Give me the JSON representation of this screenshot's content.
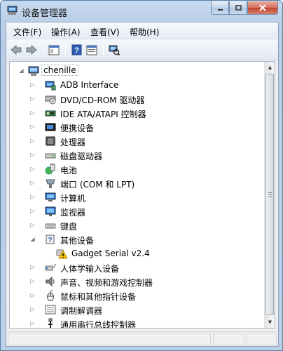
{
  "window": {
    "title": "设备管理器"
  },
  "menu": [
    {
      "label": "文件(F)"
    },
    {
      "label": "操作(A)"
    },
    {
      "label": "查看(V)"
    },
    {
      "label": "帮助(H)"
    }
  ],
  "toolbar": {
    "buttons": [
      "back-icon",
      "forward-icon",
      "show-hide-console-tree-icon",
      "help-icon",
      "properties-icon",
      "scan-hardware-icon"
    ]
  },
  "tree": {
    "root": {
      "label": "chenille"
    },
    "items": [
      {
        "label": "ADB Interface",
        "icon": "adb-device-icon"
      },
      {
        "label": "DVD/CD-ROM 驱动器",
        "icon": "cdrom-icon"
      },
      {
        "label": "IDE ATA/ATAPI 控制器",
        "icon": "ide-controller-icon"
      },
      {
        "label": "便携设备",
        "icon": "portable-device-icon"
      },
      {
        "label": "处理器",
        "icon": "processor-icon"
      },
      {
        "label": "磁盘驱动器",
        "icon": "disk-drive-icon"
      },
      {
        "label": "电池",
        "icon": "battery-icon"
      },
      {
        "label": "端口 (COM 和 LPT)",
        "icon": "port-icon"
      },
      {
        "label": "计算机",
        "icon": "computer-icon"
      },
      {
        "label": "监视器",
        "icon": "monitor-icon"
      },
      {
        "label": "键盘",
        "icon": "keyboard-icon"
      },
      {
        "label": "其他设备",
        "icon": "unknown-device-icon",
        "expanded": true
      },
      {
        "label": "Gadget Serial v2.4",
        "icon": "warning-icon",
        "child": true
      },
      {
        "label": "人体学输入设备",
        "icon": "hid-icon"
      },
      {
        "label": "声音、视频和游戏控制器",
        "icon": "sound-icon"
      },
      {
        "label": "鼠标和其他指针设备",
        "icon": "mouse-icon"
      },
      {
        "label": "调制解调器",
        "icon": "modem-icon"
      },
      {
        "label": "通用串行总线控制器",
        "icon": "usb-icon"
      }
    ]
  },
  "colors": {
    "selection_border": "#88aaaa",
    "warning": "#f5c400",
    "titlebar": "#c6d9ee"
  }
}
